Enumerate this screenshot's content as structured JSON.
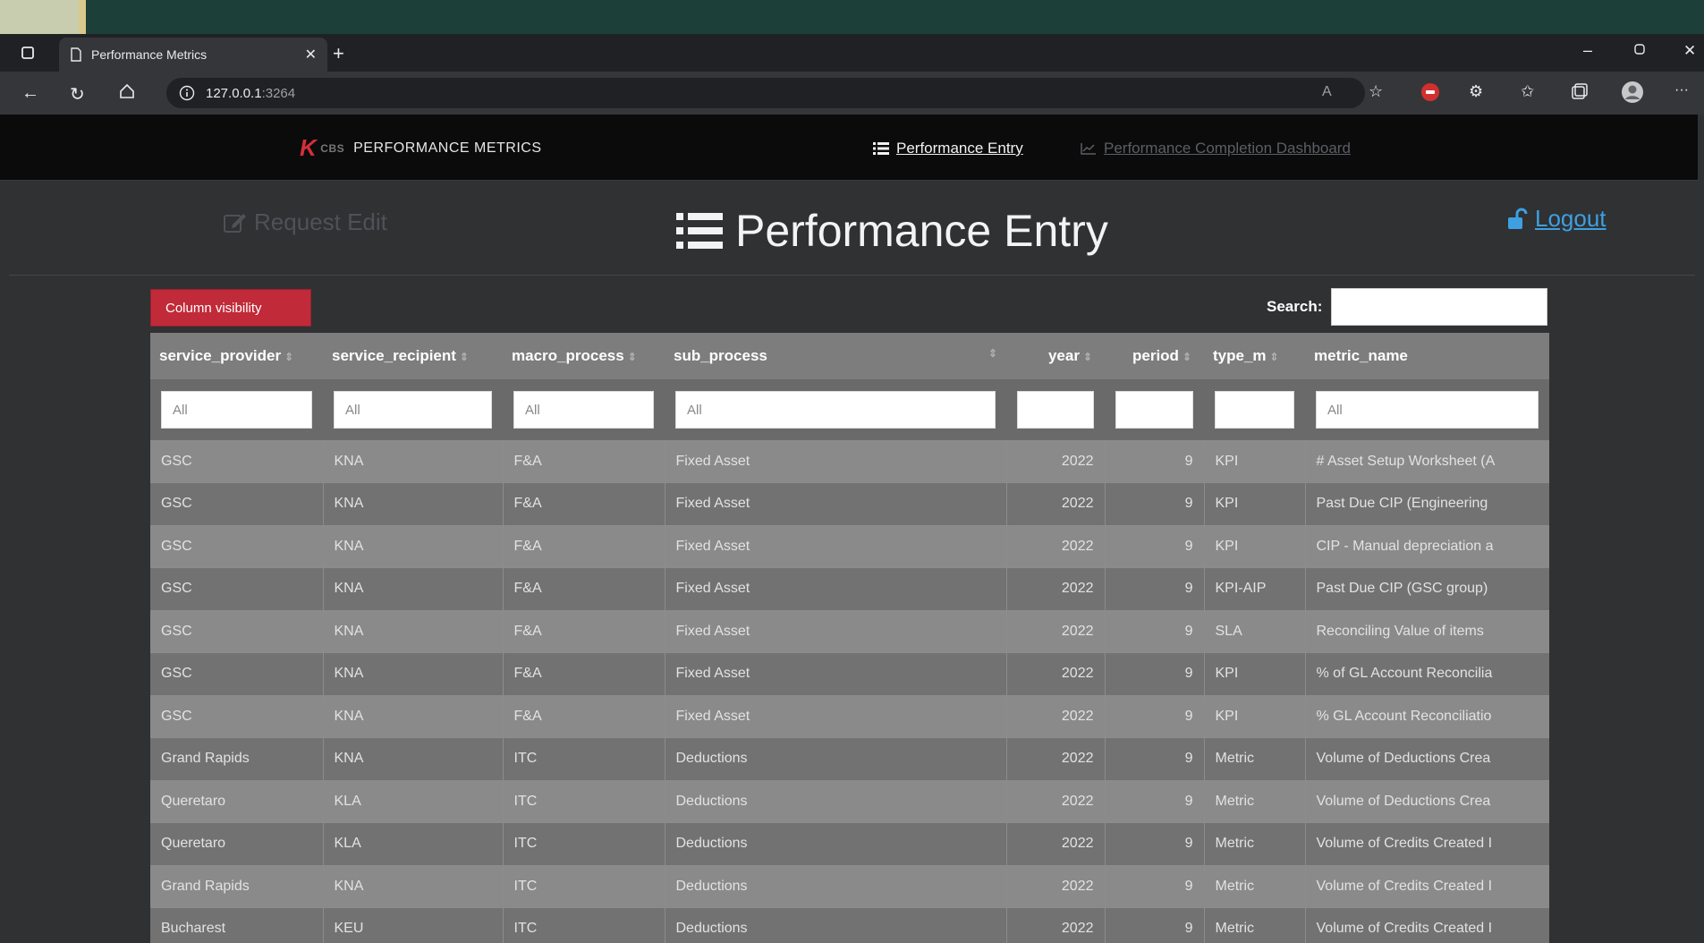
{
  "browser": {
    "tab_title": "Performance Metrics",
    "url_host": "127.0.0.1",
    "url_port": ":3264"
  },
  "navbar": {
    "brand": "PERFORMANCE METRICS",
    "logo_text": "K",
    "logo_sub": "CBS",
    "links": [
      {
        "label": "Performance Entry",
        "active": true
      },
      {
        "label": "Performance Completion Dashboard",
        "active": false
      }
    ]
  },
  "header": {
    "request_edit": "Request Edit",
    "title": "Performance Entry",
    "logout": "Logout"
  },
  "controls": {
    "column_visibility": "Column visibility",
    "search_label": "Search:",
    "search_value": ""
  },
  "table": {
    "columns": [
      "service_provider",
      "service_recipient",
      "macro_process",
      "sub_process",
      "year",
      "period",
      "type_m",
      "metric_name"
    ],
    "filters": [
      "All",
      "All",
      "All",
      "All",
      "",
      "",
      "",
      "All"
    ],
    "rows": [
      [
        "GSC",
        "KNA",
        "F&A",
        "Fixed Asset",
        "2022",
        "9",
        "KPI",
        "# Asset Setup Worksheet (A"
      ],
      [
        "GSC",
        "KNA",
        "F&A",
        "Fixed Asset",
        "2022",
        "9",
        "KPI",
        "Past Due CIP (Engineering"
      ],
      [
        "GSC",
        "KNA",
        "F&A",
        "Fixed Asset",
        "2022",
        "9",
        "KPI",
        "CIP - Manual depreciation a"
      ],
      [
        "GSC",
        "KNA",
        "F&A",
        "Fixed Asset",
        "2022",
        "9",
        "KPI-AIP",
        "Past Due CIP (GSC group)"
      ],
      [
        "GSC",
        "KNA",
        "F&A",
        "Fixed Asset",
        "2022",
        "9",
        "SLA",
        "Reconciling Value of items"
      ],
      [
        "GSC",
        "KNA",
        "F&A",
        "Fixed Asset",
        "2022",
        "9",
        "KPI",
        "% of GL Account Reconcilia"
      ],
      [
        "GSC",
        "KNA",
        "F&A",
        "Fixed Asset",
        "2022",
        "9",
        "KPI",
        "% GL Account Reconciliatio"
      ],
      [
        "Grand Rapids",
        "KNA",
        "ITC",
        "Deductions",
        "2022",
        "9",
        "Metric",
        "Volume of Deductions Crea"
      ],
      [
        "Queretaro",
        "KLA",
        "ITC",
        "Deductions",
        "2022",
        "9",
        "Metric",
        "Volume of Deductions Crea"
      ],
      [
        "Queretaro",
        "KLA",
        "ITC",
        "Deductions",
        "2022",
        "9",
        "Metric",
        "Volume of Credits Created I"
      ],
      [
        "Grand Rapids",
        "KNA",
        "ITC",
        "Deductions",
        "2022",
        "9",
        "Metric",
        "Volume of Credits Created I"
      ],
      [
        "Bucharest",
        "KEU",
        "ITC",
        "Deductions",
        "2022",
        "9",
        "Metric",
        "Volume of Credits Created I"
      ]
    ]
  }
}
